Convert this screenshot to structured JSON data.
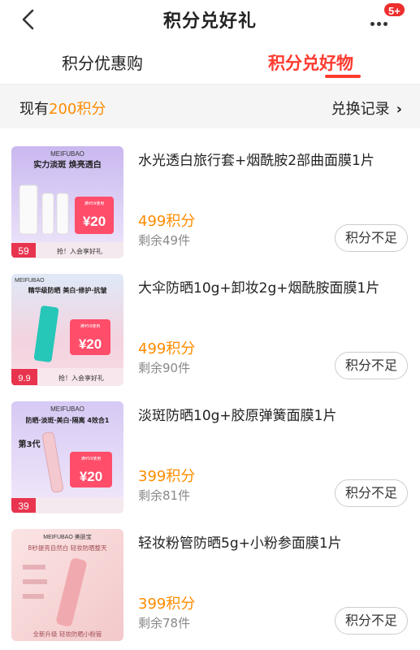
{
  "header": {
    "title": "积分兑好礼",
    "notif_badge": "5+"
  },
  "tabs": [
    {
      "label": "积分优惠购"
    },
    {
      "label": "积分兑好物",
      "active": true
    }
  ],
  "points_bar": {
    "prefix": "现有",
    "points": "200积分",
    "history_label": "兑换记录"
  },
  "colors": {
    "accent_red": "#ff3b30",
    "points_orange": "#ff8c00"
  },
  "products": [
    {
      "name": "水光透白旅行套+烟酰胺2部曲面膜1片",
      "price": "499积分",
      "stock": "剩余49件",
      "button": "积分不足",
      "thumb": {
        "brand": "MEIFUBAO",
        "headline": "实力淡斑 焕亮透白",
        "coupon": "¥20",
        "coupon_note": "满¥59使用",
        "tag": "59",
        "footer": "抢！入会享好礼"
      }
    },
    {
      "name": "大伞防晒10g+卸妆2g+烟酰胺面膜1片",
      "price": "499积分",
      "stock": "剩余90件",
      "button": "积分不足",
      "thumb": {
        "brand": "MEIFUBAO",
        "headline": "精华级防晒 美白·修护·抗皱",
        "coupon": "¥20",
        "coupon_note": "满¥59使用",
        "tag": "9.9",
        "footer": "抢！入会享好礼"
      }
    },
    {
      "name": "淡斑防晒10g+胶原弹簧面膜1片",
      "price": "399积分",
      "stock": "剩余81件",
      "button": "积分不足",
      "thumb": {
        "brand": "MEIFUBAO",
        "headline": "防晒·淡斑·美白·隔离 4效合1",
        "coupon": "¥20",
        "coupon_note": "满¥59使用",
        "tag": "39",
        "side": "第3代",
        "footer": ""
      }
    },
    {
      "name": "轻妆粉管防晒5g+小粉参面膜1片",
      "price": "399积分",
      "stock": "剩余78件",
      "button": "积分不足",
      "thumb": {
        "brand": "MEIFUBAO 美肤宝",
        "headline": "8秒提亮自然白 轻妆防晒整天",
        "coupon": "",
        "coupon_note": "",
        "tag": "",
        "footer": "全新升级 轻妆防晒小粉管"
      }
    }
  ]
}
